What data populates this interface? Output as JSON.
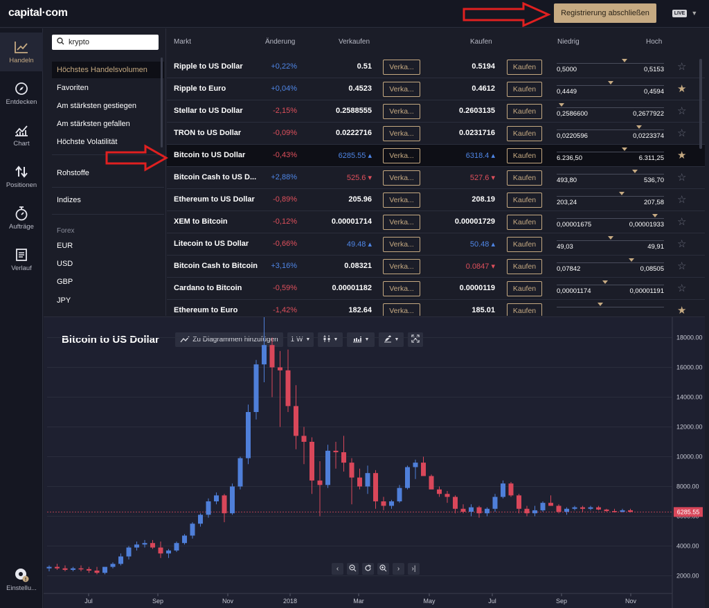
{
  "header": {
    "logo": "capital·com",
    "register_button": "Registrierung abschließen",
    "mode_badge": "LIVE"
  },
  "sidebar": {
    "items": [
      {
        "label": "Handeln",
        "icon": "trend-up-icon",
        "active": true
      },
      {
        "label": "Entdecken",
        "icon": "compass-icon"
      },
      {
        "label": "Chart",
        "icon": "chart-icon"
      },
      {
        "label": "Positionen",
        "icon": "arrows-updown-icon"
      },
      {
        "label": "Aufträge",
        "icon": "stopwatch-icon"
      },
      {
        "label": "Verlauf",
        "icon": "document-icon"
      }
    ],
    "settings_label": "Einstellu..."
  },
  "filter": {
    "search_value": "krypto",
    "categories": [
      "Höchstes Handelsvolumen",
      "Favoriten",
      "Am stärksten gestiegen",
      "Am stärksten gefallen",
      "Höchste Volatilität"
    ],
    "rohstoffe": "Rohstoffe",
    "indizes": "Indizes",
    "forex_heading": "Forex",
    "forex": [
      "EUR",
      "USD",
      "GBP",
      "JPY"
    ]
  },
  "market": {
    "columns": {
      "market": "Markt",
      "change": "Änderung",
      "sell": "Verkaufen",
      "buy": "Kaufen",
      "low": "Niedrig",
      "high": "Hoch"
    },
    "sell_label": "Verka...",
    "buy_label": "Kaufen",
    "rows": [
      {
        "name": "Ripple to US Dollar",
        "change": "+0,22%",
        "sell": "0.51",
        "buy": "0.5194",
        "low": "0,5000",
        "high": "0,5153",
        "pos": 0.64,
        "fav": false
      },
      {
        "name": "Ripple to Euro",
        "change": "+0,04%",
        "sell": "0.4523",
        "buy": "0.4612",
        "low": "0,4449",
        "high": "0,4594",
        "pos": 0.5,
        "fav": true
      },
      {
        "name": "Stellar to US Dollar",
        "change": "-2,15%",
        "sell": "0.2588555",
        "buy": "0.2603135",
        "low": "0,2586600",
        "high": "0,2677922",
        "pos": 0.02,
        "fav": false
      },
      {
        "name": "TRON to US Dollar",
        "change": "-0,09%",
        "sell": "0.0222716",
        "buy": "0.0231716",
        "low": "0,0220596",
        "high": "0,0223374",
        "pos": 0.78,
        "fav": false
      },
      {
        "name": "Bitcoin to US Dollar",
        "change": "-0,43%",
        "sell": "6285.55",
        "buy": "6318.4",
        "sell_tick": "up",
        "buy_tick": "up",
        "low": "6.236,50",
        "high": "6.311,25",
        "pos": 0.64,
        "fav": true,
        "highlight": true
      },
      {
        "name": "Bitcoin Cash to US D...",
        "change": "+2,88%",
        "sell": "525.6",
        "buy": "527.6",
        "sell_tick": "down",
        "buy_tick": "down",
        "low": "493,80",
        "high": "536,70",
        "pos": 0.74,
        "fav": false
      },
      {
        "name": "Ethereum to US Dollar",
        "change": "-0,89%",
        "sell": "205.96",
        "buy": "208.19",
        "low": "203,24",
        "high": "207,58",
        "pos": 0.61,
        "fav": false
      },
      {
        "name": "XEM to Bitcoin",
        "change": "-0,12%",
        "sell": "0.00001714",
        "buy": "0.00001729",
        "low": "0,00001675",
        "high": "0,00001933",
        "pos": 0.94,
        "fav": false
      },
      {
        "name": "Litecoin to US Dollar",
        "change": "-0,66%",
        "sell": "49.48",
        "buy": "50.48",
        "sell_tick": "up",
        "buy_tick": "up",
        "low": "49,03",
        "high": "49,91",
        "pos": 0.5,
        "fav": false
      },
      {
        "name": "Bitcoin Cash to Bitcoin",
        "change": "+3,16%",
        "sell": "0.08321",
        "buy": "0.0847",
        "buy_tick": "down",
        "low": "0,07842",
        "high": "0,08505",
        "pos": 0.71,
        "fav": false
      },
      {
        "name": "Cardano to Bitcoin",
        "change": "-0,59%",
        "sell": "0.00001182",
        "buy": "0.0000119",
        "low": "0,00001174",
        "high": "0,00001191",
        "pos": 0.45,
        "fav": false
      },
      {
        "name": "Ethereum to Euro",
        "change": "-1,42%",
        "sell": "182.64",
        "buy": "185.01",
        "low": "",
        "high": "",
        "pos": 0.4,
        "fav": true
      }
    ]
  },
  "chart_panel": {
    "title": "Bitcoin to US Dollar",
    "add_button": "Zu Diagrammen hinzufügen",
    "interval": "1 W",
    "price_label": "6285.55"
  },
  "chart_data": {
    "type": "candlestick",
    "title": "Bitcoin to US Dollar",
    "interval": "1 W",
    "x_ticks": [
      "Jul",
      "Sep",
      "Nov",
      "2018",
      "Mar",
      "May",
      "Jul",
      "Sep",
      "Nov"
    ],
    "y_ticks": [
      "2000.00",
      "4000.00",
      "6000.00",
      "8000.00",
      "10000.00",
      "12000.00",
      "14000.00",
      "16000.00",
      "18000.00"
    ],
    "ylim": [
      1000,
      19000
    ],
    "current_price": 6285.55,
    "candles": [
      [
        2500,
        2700,
        2300,
        2600
      ],
      [
        2600,
        2800,
        2400,
        2500
      ],
      [
        2500,
        2700,
        2300,
        2400
      ],
      [
        2400,
        2600,
        2300,
        2500
      ],
      [
        2500,
        2700,
        2300,
        2450
      ],
      [
        2450,
        2600,
        2200,
        2350
      ],
      [
        2350,
        2600,
        2100,
        2200
      ],
      [
        2200,
        2500,
        2100,
        2600
      ],
      [
        2600,
        2900,
        2500,
        2800
      ],
      [
        2800,
        3500,
        2700,
        3300
      ],
      [
        3300,
        4000,
        3100,
        3900
      ],
      [
        3900,
        4300,
        3700,
        4100
      ],
      [
        4100,
        4400,
        3900,
        4200
      ],
      [
        4200,
        4400,
        3800,
        3900
      ],
      [
        3900,
        4300,
        3200,
        3500
      ],
      [
        3500,
        3800,
        3200,
        3700
      ],
      [
        3700,
        4300,
        3600,
        4200
      ],
      [
        4200,
        4800,
        4100,
        4700
      ],
      [
        4700,
        5600,
        4500,
        5500
      ],
      [
        5500,
        6200,
        5300,
        6100
      ],
      [
        6100,
        7200,
        5900,
        7000
      ],
      [
        7000,
        7600,
        6800,
        7400
      ],
      [
        7400,
        7500,
        5600,
        6200
      ],
      [
        6200,
        8200,
        6100,
        8000
      ],
      [
        8000,
        10000,
        7800,
        9900
      ],
      [
        9900,
        13500,
        9500,
        13000
      ],
      [
        13000,
        16500,
        12500,
        16200
      ],
      [
        16200,
        19500,
        15000,
        17500
      ],
      [
        17500,
        18000,
        14000,
        16000
      ],
      [
        16000,
        17100,
        12000,
        15800
      ],
      [
        15800,
        17200,
        13000,
        13400
      ],
      [
        13400,
        14800,
        10500,
        11400
      ],
      [
        11400,
        12000,
        9500,
        11000
      ],
      [
        11000,
        11300,
        7500,
        8400
      ],
      [
        8400,
        9700,
        6000,
        8100
      ],
      [
        8100,
        10800,
        7900,
        10400
      ],
      [
        10400,
        11000,
        9200,
        10300
      ],
      [
        10300,
        11400,
        9000,
        9600
      ],
      [
        9600,
        9900,
        6800,
        8600
      ],
      [
        8600,
        9200,
        7800,
        8000
      ],
      [
        8000,
        9400,
        7500,
        8900
      ],
      [
        8900,
        9100,
        6500,
        7000
      ],
      [
        7000,
        7300,
        6400,
        6700
      ],
      [
        6700,
        7100,
        6500,
        7000
      ],
      [
        7000,
        8100,
        6900,
        7900
      ],
      [
        7900,
        9400,
        7800,
        9300
      ],
      [
        9300,
        9800,
        8500,
        9600
      ],
      [
        9600,
        10000,
        8800,
        8700
      ],
      [
        8700,
        8800,
        7900,
        7800
      ],
      [
        7800,
        8000,
        7300,
        7500
      ],
      [
        7500,
        7700,
        6900,
        7300
      ],
      [
        7300,
        7400,
        6200,
        6500
      ],
      [
        6500,
        6800,
        6200,
        6300
      ],
      [
        6300,
        6800,
        6000,
        6600
      ],
      [
        6600,
        6700,
        5900,
        6200
      ],
      [
        6200,
        6600,
        6000,
        6500
      ],
      [
        6500,
        7500,
        6300,
        7300
      ],
      [
        7300,
        8400,
        7200,
        8200
      ],
      [
        8200,
        8300,
        7300,
        7400
      ],
      [
        7400,
        7500,
        6200,
        6500
      ],
      [
        6500,
        6700,
        6000,
        6200
      ],
      [
        6200,
        6700,
        6000,
        6400
      ],
      [
        6400,
        7000,
        6300,
        6900
      ],
      [
        6900,
        7400,
        6700,
        6700
      ],
      [
        6700,
        6800,
        6200,
        6300
      ],
      [
        6300,
        6600,
        6100,
        6500
      ],
      [
        6500,
        6700,
        6400,
        6600
      ],
      [
        6600,
        6700,
        6300,
        6500
      ],
      [
        6500,
        6700,
        6400,
        6600
      ],
      [
        6600,
        6700,
        6400,
        6450
      ],
      [
        6450,
        6500,
        6300,
        6350
      ],
      [
        6350,
        6500,
        6250,
        6300
      ],
      [
        6300,
        6500,
        6250,
        6400
      ],
      [
        6400,
        6500,
        6250,
        6300
      ]
    ]
  }
}
